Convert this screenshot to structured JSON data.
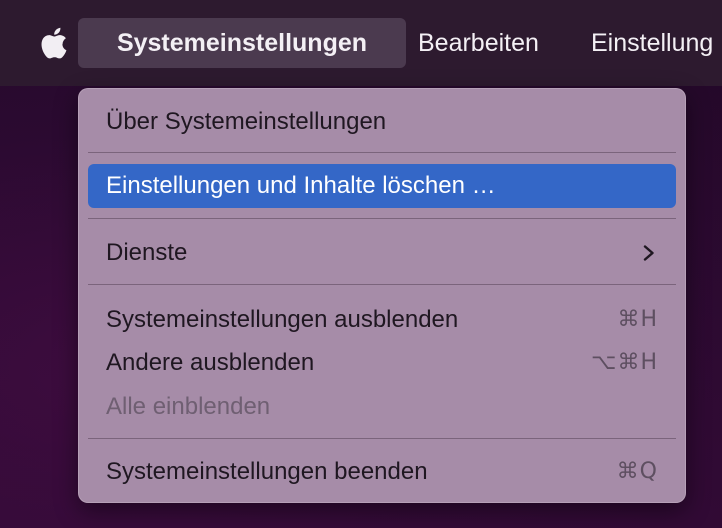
{
  "menubar": {
    "apple_icon": "apple-logo-icon",
    "items": [
      {
        "label": "Systemeinstellungen"
      },
      {
        "label": "Bearbeiten"
      },
      {
        "label": "Einstellung"
      }
    ]
  },
  "dropdown": {
    "about": "Über Systemeinstellungen",
    "erase": "Einstellungen und Inhalte löschen …",
    "services": "Dienste",
    "services_icon": "chevron-right-icon",
    "hide": {
      "label": "Systemeinstellungen ausblenden",
      "shortcut": "⌘H"
    },
    "hide_others": {
      "label": "Andere ausblenden",
      "shortcut": "⌥⌘H"
    },
    "show_all": "Alle einblenden",
    "quit": {
      "label": "Systemeinstellungen beenden",
      "shortcut": "⌘Q"
    }
  },
  "colors": {
    "highlight": "#3467c7",
    "menu_background": "#a68ca8",
    "menubar": "#2d1a2f"
  }
}
